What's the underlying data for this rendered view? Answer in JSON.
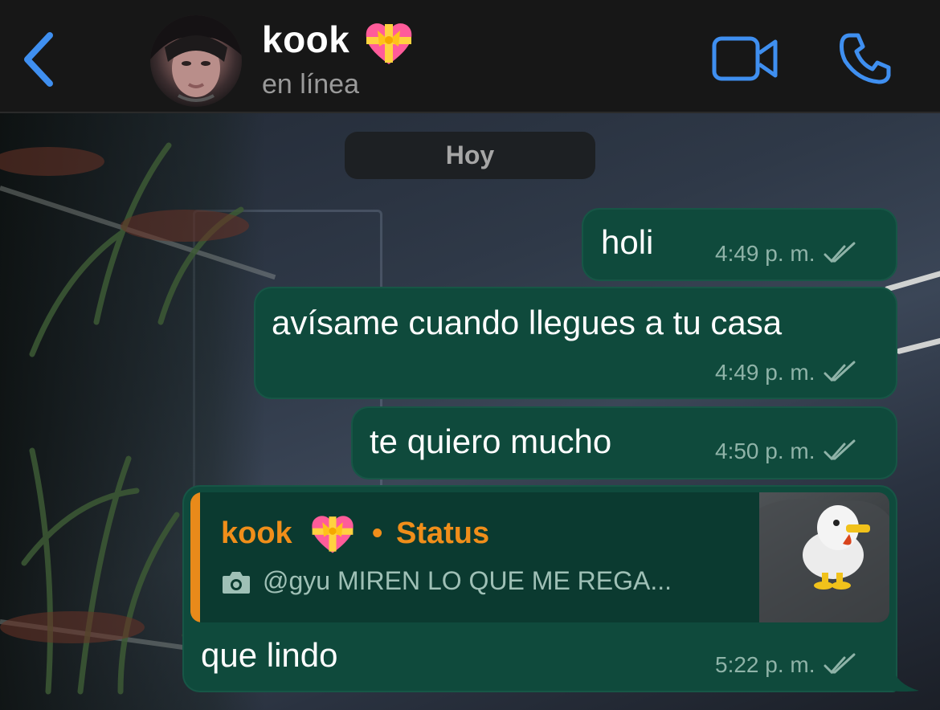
{
  "header": {
    "back_label": "<",
    "contact_name": "kook",
    "contact_emoji": "heart-with-ribbon-emoji",
    "status": "en línea",
    "video_icon": "video-camera-icon",
    "call_icon": "phone-icon"
  },
  "chat": {
    "date_separator": "Hoy",
    "messages": [
      {
        "text": "holi",
        "time": "4:49 p. m.",
        "read": true
      },
      {
        "text": "avísame cuando llegues a tu casa",
        "time": "4:49 p. m.",
        "read": true
      },
      {
        "text": "te quiero mucho",
        "time": "4:50 p. m.",
        "read": true
      },
      {
        "reply_to": {
          "author": "kook",
          "author_emoji": "heart-with-ribbon-emoji",
          "separator": "•",
          "kind": "Status",
          "snippet": "@gyu MIREN LO QUE ME REGA...",
          "snippet_icon": "camera-icon",
          "thumbnail": "duck-plush-photo"
        },
        "text": "que lindo",
        "time": "5:22 p. m.",
        "read": true
      }
    ]
  },
  "colors": {
    "header_bg": "#171717",
    "accent_blue": "#3f8ff0",
    "bubble_green": "#0f4a3c",
    "reply_accent": "#e88a1a",
    "timestamp": "#8fb3a8"
  }
}
